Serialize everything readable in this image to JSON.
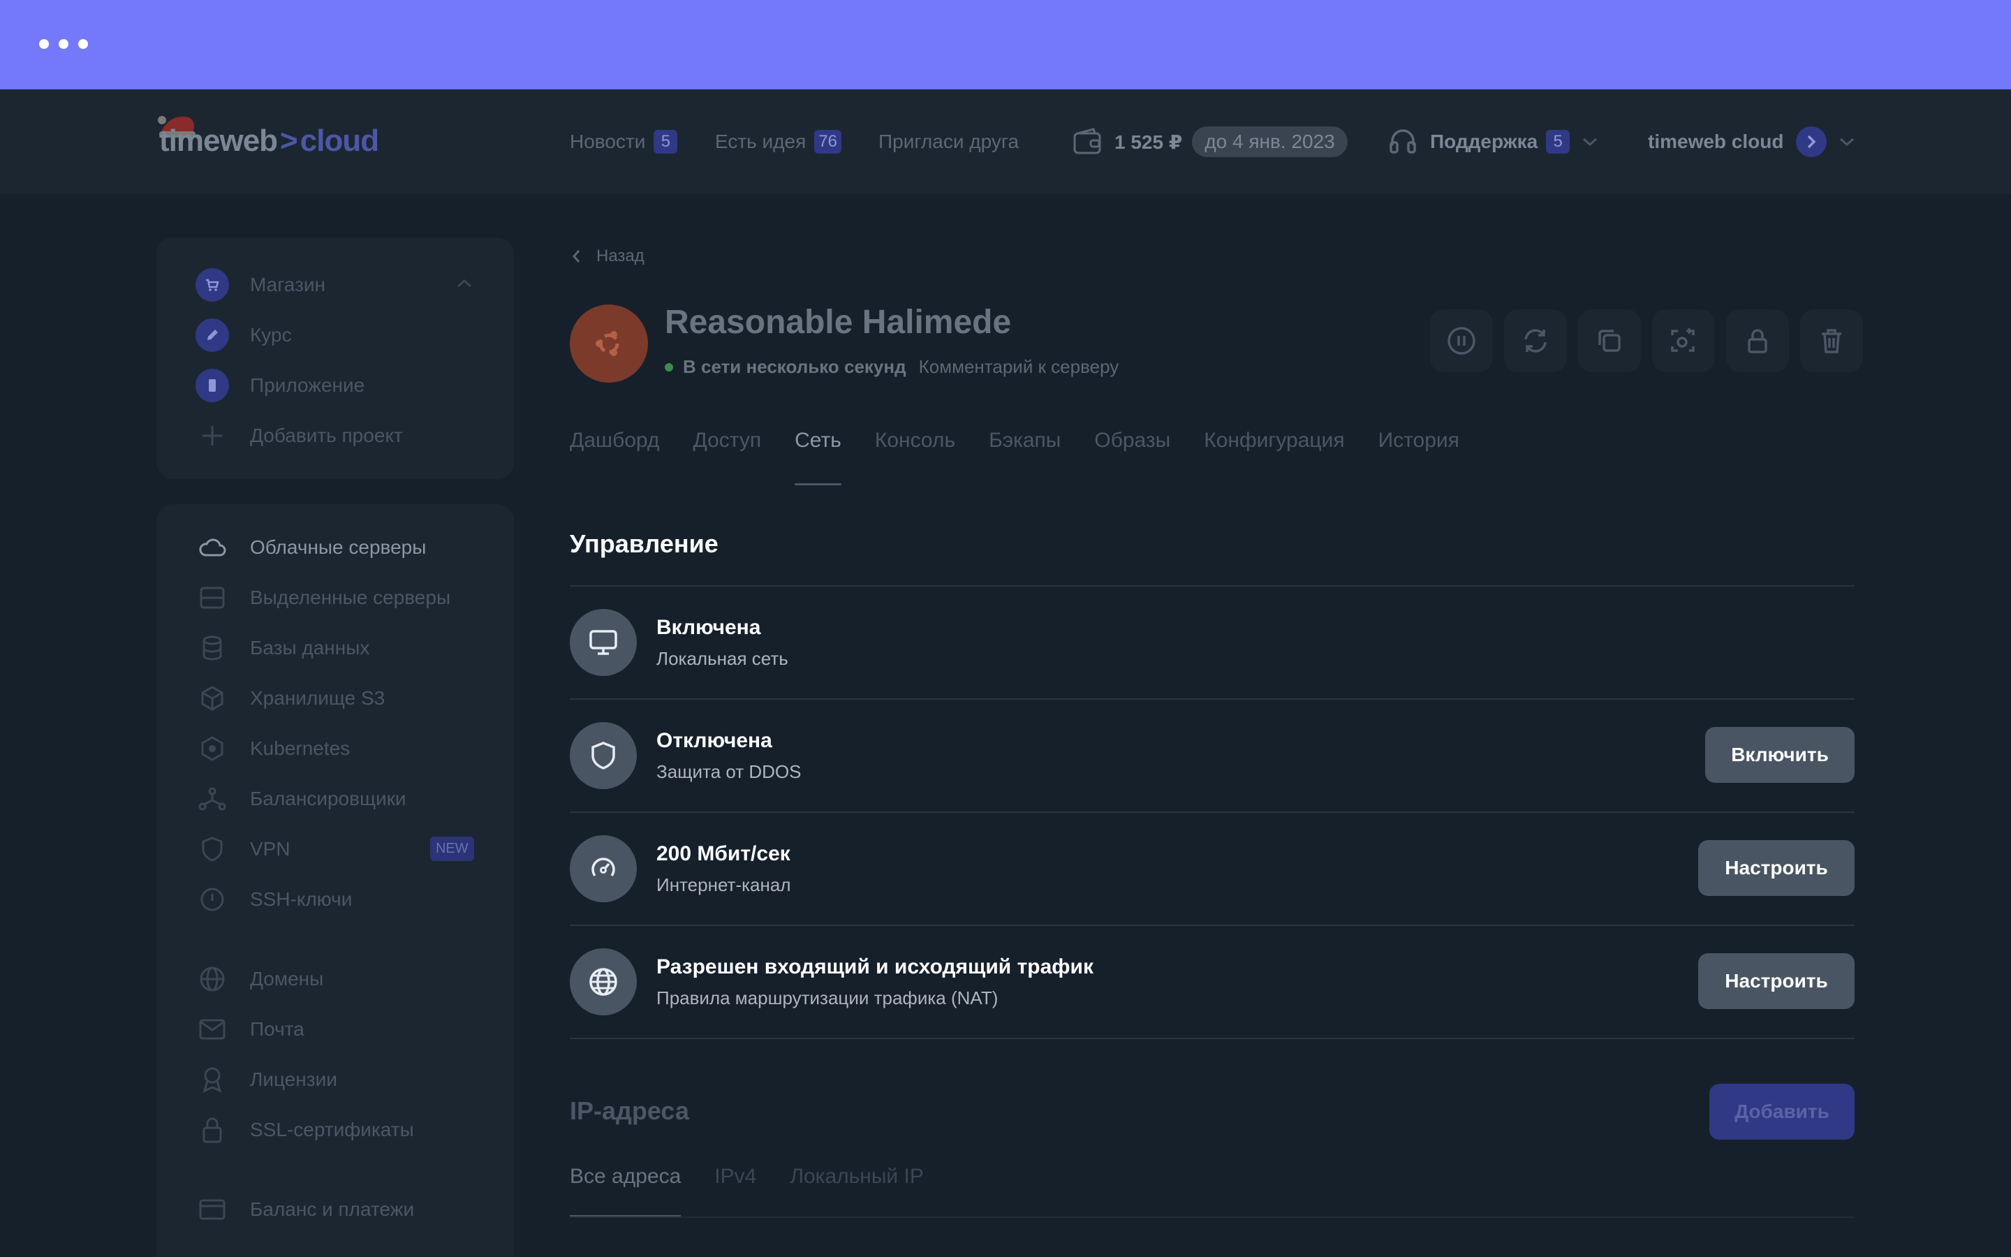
{
  "header": {
    "logo": {
      "part1": "timeweb",
      "sep": ">",
      "part2": "cloud"
    },
    "nav": [
      {
        "label": "Новости",
        "badge": "5"
      },
      {
        "label": "Есть идея",
        "badge": "76"
      },
      {
        "label": "Пригласи друга"
      }
    ],
    "balance": "1 525 ₽",
    "balance_until": "до 4 янв. 2023",
    "support_label": "Поддержка",
    "support_badge": "5",
    "account_name": "timeweb cloud"
  },
  "sidebar": {
    "projects": [
      {
        "label": "Магазин",
        "icon": "cart-icon"
      },
      {
        "label": "Курс",
        "icon": "pencil-icon"
      },
      {
        "label": "Приложение",
        "icon": "phone-icon"
      },
      {
        "label": "Добавить проект",
        "icon": "plus-icon"
      }
    ],
    "services": [
      {
        "label": "Облачные серверы",
        "icon": "cloud-icon"
      },
      {
        "label": "Выделенные серверы",
        "icon": "server-icon"
      },
      {
        "label": "Базы данных",
        "icon": "database-icon"
      },
      {
        "label": "Хранилище S3",
        "icon": "cube-icon"
      },
      {
        "label": "Kubernetes",
        "icon": "kubernetes-icon"
      },
      {
        "label": "Балансировщики",
        "icon": "balancer-icon"
      },
      {
        "label": "VPN",
        "icon": "shield-icon",
        "badge": "NEW"
      },
      {
        "label": "SSH-ключи",
        "icon": "key-icon"
      },
      {
        "label": "Домены",
        "icon": "globe-icon"
      },
      {
        "label": "Почта",
        "icon": "mail-icon"
      },
      {
        "label": "Лицензии",
        "icon": "license-icon"
      },
      {
        "label": "SSL-сертификаты",
        "icon": "lock-icon"
      },
      {
        "label": "Баланс и платежи",
        "icon": "card-icon"
      }
    ]
  },
  "server": {
    "back_label": "Назад",
    "name": "Reasonable Halimede",
    "status": "В сети несколько секунд",
    "comment_placeholder": "Комментарий к серверу"
  },
  "tabs": [
    "Дашборд",
    "Доступ",
    "Сеть",
    "Консоль",
    "Бэкапы",
    "Образы",
    "Конфигурация",
    "История"
  ],
  "active_tab": "Сеть",
  "management": {
    "title": "Управление",
    "rows": [
      {
        "title": "Включена",
        "subtitle": "Локальная сеть",
        "icon": "monitor-icon"
      },
      {
        "title": "Отключена",
        "subtitle": "Защита от DDOS",
        "icon": "shield-icon",
        "button": "Включить"
      },
      {
        "title": "200 Мбит/сек",
        "subtitle": "Интернет-канал",
        "icon": "speedometer-icon",
        "button": "Настроить"
      },
      {
        "title": "Разрешен входящий и исходящий трафик",
        "subtitle": "Правила маршрутизации трафика (NAT)",
        "icon": "globe-icon",
        "button": "Настроить"
      }
    ]
  },
  "ip": {
    "title": "IP-адреса",
    "add_label": "Добавить",
    "tabs": [
      "Все адреса",
      "IPv4",
      "Локальный IP"
    ]
  },
  "colors": {
    "top_bar": "#7479fb",
    "background": "#16202b",
    "accent": "#2f3985",
    "button": "#4a5563"
  }
}
